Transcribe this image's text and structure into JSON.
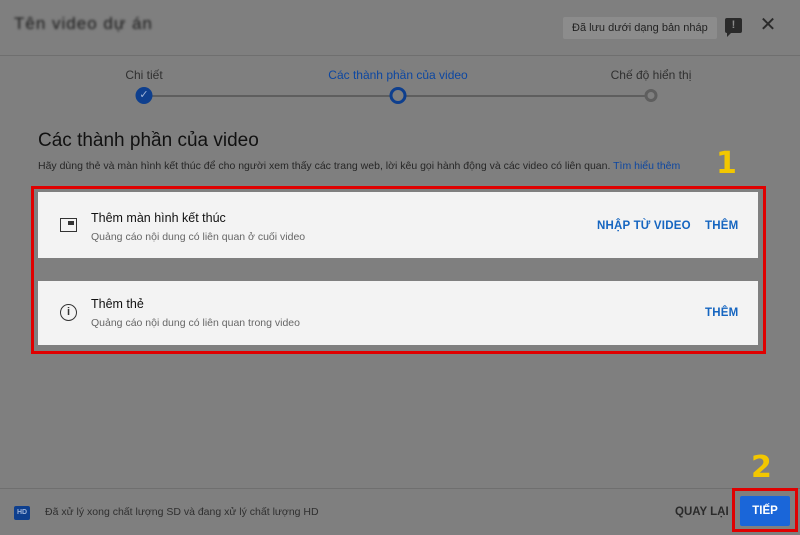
{
  "header": {
    "title": "Tên video dự án",
    "draft_status": "Đã lưu dưới dạng bản nháp",
    "feedback_glyph": "!",
    "close_glyph": "✕"
  },
  "stepper": {
    "steps": [
      {
        "label": "Chi tiết",
        "state": "done"
      },
      {
        "label": "Các thành phần của video",
        "state": "current"
      },
      {
        "label": "Chế độ hiển thị",
        "state": "future"
      }
    ],
    "done_glyph": "✓"
  },
  "main": {
    "title": "Các thành phần của video",
    "description": "Hãy dùng thẻ và màn hình kết thúc để cho người xem thấy các trang web, lời kêu gọi hành động và các video có liên quan.",
    "learn_more": "Tìm hiểu thêm",
    "cards": [
      {
        "icon": "end-screen-icon",
        "title": "Thêm màn hình kết thúc",
        "subtitle": "Quảng cáo nội dung có liên quan ở cuối video",
        "import_label": "NHẬP TỪ VIDEO",
        "add_label": "THÊM"
      },
      {
        "icon": "info-icon",
        "icon_glyph": "i",
        "title": "Thêm thẻ",
        "subtitle": "Quảng cáo nội dung có liên quan trong video",
        "add_label": "THÊM"
      }
    ]
  },
  "annotations": {
    "number_1": "1",
    "number_2": "2",
    "highlight_color": "#e00000",
    "number_color": "#f2c700"
  },
  "footer": {
    "hd_badge": "HD",
    "status": "Đã xử lý xong chất lượng SD và đang xử lý chất lượng HD",
    "back_label": "QUAY LẠI",
    "next_label": "TIẾP"
  },
  "colors": {
    "accent": "#1565c0",
    "primary_button": "#1a66d9",
    "overlay": "#7f7f7f"
  }
}
